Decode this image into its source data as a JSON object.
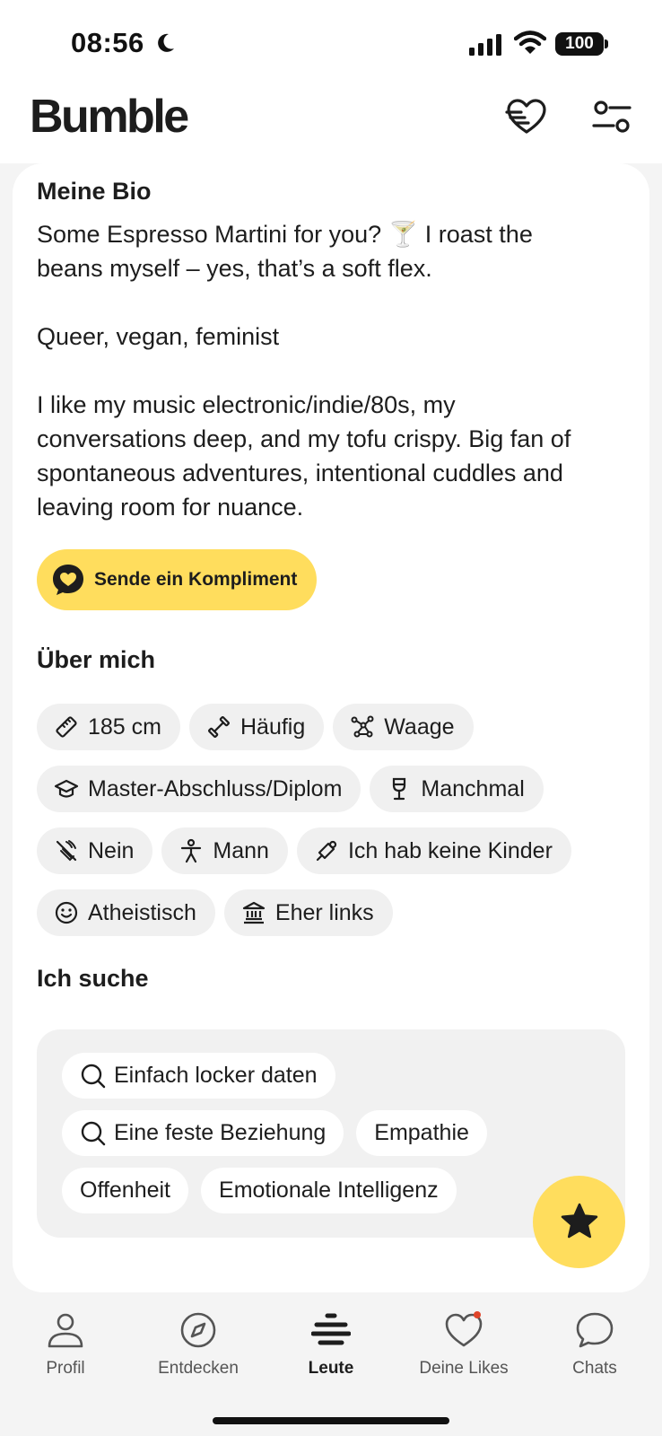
{
  "status_bar": {
    "time": "08:56",
    "battery": "100"
  },
  "header": {
    "logo": "Bumble",
    "icons": [
      "heart-lines-icon",
      "filter-icon"
    ]
  },
  "bio": {
    "title": "Meine Bio",
    "text": "Some Espresso Martini for you? 🍸 I roast the\nbeans myself – yes, that’s a soft flex.\n\nQueer, vegan, feminist\n\nI like my music electronic/indie/80s, my\nconversations deep, and my tofu crispy. Big fan of\nspontaneous adventures, intentional cuddles and\nleaving room for nuance.",
    "compliment_button": "Sende ein Kompliment"
  },
  "about": {
    "title": "Über mich",
    "chips": [
      {
        "label": "185 cm",
        "icon": "ruler-icon"
      },
      {
        "label": "Häufig",
        "icon": "dumbbell-icon"
      },
      {
        "label": "Waage",
        "icon": "zodiac-icon"
      },
      {
        "label": "Master-Abschluss/Diplom",
        "icon": "graduation-cap-icon"
      },
      {
        "label": "Manchmal",
        "icon": "wine-glass-icon"
      },
      {
        "label": "Nein",
        "icon": "no-smoking-icon"
      },
      {
        "label": "Mann",
        "icon": "person-icon"
      },
      {
        "label": "Ich hab keine Kinder",
        "icon": "pacifier-icon"
      },
      {
        "label": "Atheistisch",
        "icon": "smiley-icon"
      },
      {
        "label": "Eher links",
        "icon": "government-building-icon"
      }
    ]
  },
  "looking_for": {
    "title": "Ich suche",
    "chips": [
      {
        "label": "Einfach locker daten",
        "icon": "search-icon"
      },
      {
        "label": "Eine feste Beziehung",
        "icon": "search-icon"
      },
      {
        "label": "Empathie",
        "icon": ""
      },
      {
        "label": "Offenheit",
        "icon": ""
      },
      {
        "label": "Emotionale Intelligenz",
        "icon": ""
      }
    ]
  },
  "nav": {
    "items": [
      {
        "label": "Profil",
        "icon": "profile-icon"
      },
      {
        "label": "Entdecken",
        "icon": "compass-icon"
      },
      {
        "label": "Leute",
        "icon": "people-stack-icon",
        "active": true
      },
      {
        "label": "Deine Likes",
        "icon": "heart-icon",
        "badge": true
      },
      {
        "label": "Chats",
        "icon": "chat-bubble-icon"
      }
    ]
  },
  "colors": {
    "accent": "#ffdd5d",
    "badge": "#e0452a",
    "chip_bg": "#f0f0f0"
  }
}
